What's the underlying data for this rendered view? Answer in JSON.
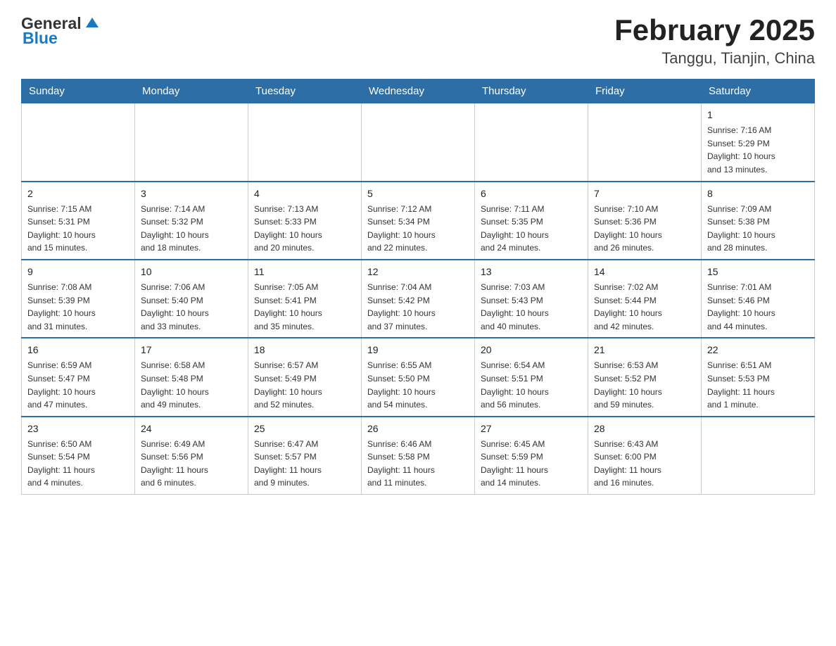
{
  "header": {
    "logo_general": "General",
    "logo_blue": "Blue",
    "title": "February 2025",
    "subtitle": "Tanggu, Tianjin, China"
  },
  "days_of_week": [
    "Sunday",
    "Monday",
    "Tuesday",
    "Wednesday",
    "Thursday",
    "Friday",
    "Saturday"
  ],
  "weeks": [
    {
      "days": [
        {
          "num": "",
          "info": ""
        },
        {
          "num": "",
          "info": ""
        },
        {
          "num": "",
          "info": ""
        },
        {
          "num": "",
          "info": ""
        },
        {
          "num": "",
          "info": ""
        },
        {
          "num": "",
          "info": ""
        },
        {
          "num": "1",
          "info": "Sunrise: 7:16 AM\nSunset: 5:29 PM\nDaylight: 10 hours\nand 13 minutes."
        }
      ]
    },
    {
      "days": [
        {
          "num": "2",
          "info": "Sunrise: 7:15 AM\nSunset: 5:31 PM\nDaylight: 10 hours\nand 15 minutes."
        },
        {
          "num": "3",
          "info": "Sunrise: 7:14 AM\nSunset: 5:32 PM\nDaylight: 10 hours\nand 18 minutes."
        },
        {
          "num": "4",
          "info": "Sunrise: 7:13 AM\nSunset: 5:33 PM\nDaylight: 10 hours\nand 20 minutes."
        },
        {
          "num": "5",
          "info": "Sunrise: 7:12 AM\nSunset: 5:34 PM\nDaylight: 10 hours\nand 22 minutes."
        },
        {
          "num": "6",
          "info": "Sunrise: 7:11 AM\nSunset: 5:35 PM\nDaylight: 10 hours\nand 24 minutes."
        },
        {
          "num": "7",
          "info": "Sunrise: 7:10 AM\nSunset: 5:36 PM\nDaylight: 10 hours\nand 26 minutes."
        },
        {
          "num": "8",
          "info": "Sunrise: 7:09 AM\nSunset: 5:38 PM\nDaylight: 10 hours\nand 28 minutes."
        }
      ]
    },
    {
      "days": [
        {
          "num": "9",
          "info": "Sunrise: 7:08 AM\nSunset: 5:39 PM\nDaylight: 10 hours\nand 31 minutes."
        },
        {
          "num": "10",
          "info": "Sunrise: 7:06 AM\nSunset: 5:40 PM\nDaylight: 10 hours\nand 33 minutes."
        },
        {
          "num": "11",
          "info": "Sunrise: 7:05 AM\nSunset: 5:41 PM\nDaylight: 10 hours\nand 35 minutes."
        },
        {
          "num": "12",
          "info": "Sunrise: 7:04 AM\nSunset: 5:42 PM\nDaylight: 10 hours\nand 37 minutes."
        },
        {
          "num": "13",
          "info": "Sunrise: 7:03 AM\nSunset: 5:43 PM\nDaylight: 10 hours\nand 40 minutes."
        },
        {
          "num": "14",
          "info": "Sunrise: 7:02 AM\nSunset: 5:44 PM\nDaylight: 10 hours\nand 42 minutes."
        },
        {
          "num": "15",
          "info": "Sunrise: 7:01 AM\nSunset: 5:46 PM\nDaylight: 10 hours\nand 44 minutes."
        }
      ]
    },
    {
      "days": [
        {
          "num": "16",
          "info": "Sunrise: 6:59 AM\nSunset: 5:47 PM\nDaylight: 10 hours\nand 47 minutes."
        },
        {
          "num": "17",
          "info": "Sunrise: 6:58 AM\nSunset: 5:48 PM\nDaylight: 10 hours\nand 49 minutes."
        },
        {
          "num": "18",
          "info": "Sunrise: 6:57 AM\nSunset: 5:49 PM\nDaylight: 10 hours\nand 52 minutes."
        },
        {
          "num": "19",
          "info": "Sunrise: 6:55 AM\nSunset: 5:50 PM\nDaylight: 10 hours\nand 54 minutes."
        },
        {
          "num": "20",
          "info": "Sunrise: 6:54 AM\nSunset: 5:51 PM\nDaylight: 10 hours\nand 56 minutes."
        },
        {
          "num": "21",
          "info": "Sunrise: 6:53 AM\nSunset: 5:52 PM\nDaylight: 10 hours\nand 59 minutes."
        },
        {
          "num": "22",
          "info": "Sunrise: 6:51 AM\nSunset: 5:53 PM\nDaylight: 11 hours\nand 1 minute."
        }
      ]
    },
    {
      "days": [
        {
          "num": "23",
          "info": "Sunrise: 6:50 AM\nSunset: 5:54 PM\nDaylight: 11 hours\nand 4 minutes."
        },
        {
          "num": "24",
          "info": "Sunrise: 6:49 AM\nSunset: 5:56 PM\nDaylight: 11 hours\nand 6 minutes."
        },
        {
          "num": "25",
          "info": "Sunrise: 6:47 AM\nSunset: 5:57 PM\nDaylight: 11 hours\nand 9 minutes."
        },
        {
          "num": "26",
          "info": "Sunrise: 6:46 AM\nSunset: 5:58 PM\nDaylight: 11 hours\nand 11 minutes."
        },
        {
          "num": "27",
          "info": "Sunrise: 6:45 AM\nSunset: 5:59 PM\nDaylight: 11 hours\nand 14 minutes."
        },
        {
          "num": "28",
          "info": "Sunrise: 6:43 AM\nSunset: 6:00 PM\nDaylight: 11 hours\nand 16 minutes."
        },
        {
          "num": "",
          "info": ""
        }
      ]
    }
  ]
}
